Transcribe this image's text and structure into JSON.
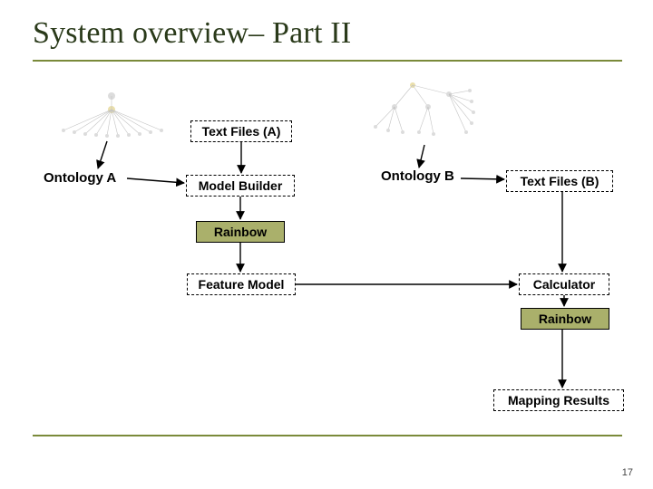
{
  "title": "System overview– Part II",
  "labels": {
    "ontology_a": "Ontology A",
    "ontology_b": "Ontology B"
  },
  "boxes": {
    "text_files_a": "Text Files (A)",
    "model_builder": "Model Builder",
    "rainbow1": "Rainbow",
    "feature_model": "Feature Model",
    "text_files_b": "Text Files (B)",
    "calculator": "Calculator",
    "rainbow2": "Rainbow",
    "mapping_results": "Mapping Results"
  },
  "page_number": "17"
}
